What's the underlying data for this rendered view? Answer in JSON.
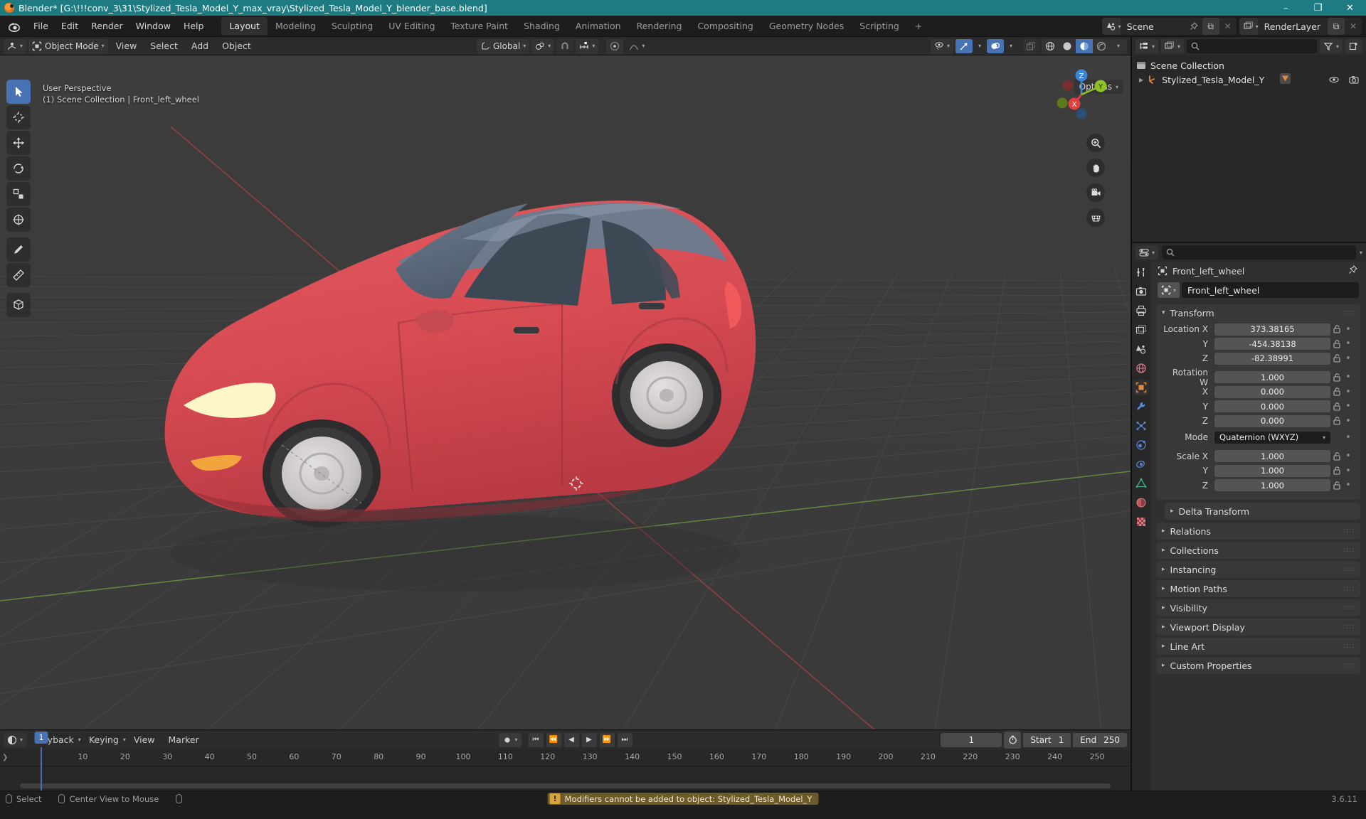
{
  "titlebar": {
    "title": "Blender* [G:\\!!!conv_3\\31\\Stylized_Tesla_Model_Y_max_vray\\Stylized_Tesla_Model_Y_blender_base.blend]",
    "icon": "blender-logo-icon",
    "minimize": "–",
    "maximize": "❐",
    "close": "✕"
  },
  "topbar": {
    "menus": [
      "File",
      "Edit",
      "Render",
      "Window",
      "Help"
    ],
    "workspaces": [
      {
        "label": "Layout",
        "active": true
      },
      {
        "label": "Modeling",
        "active": false
      },
      {
        "label": "Sculpting",
        "active": false
      },
      {
        "label": "UV Editing",
        "active": false
      },
      {
        "label": "Texture Paint",
        "active": false
      },
      {
        "label": "Shading",
        "active": false
      },
      {
        "label": "Animation",
        "active": false
      },
      {
        "label": "Rendering",
        "active": false
      },
      {
        "label": "Compositing",
        "active": false
      },
      {
        "label": "Geometry Nodes",
        "active": false
      },
      {
        "label": "Scripting",
        "active": false
      }
    ],
    "add_workspace": "+",
    "scene": {
      "label": "Scene",
      "icon": "scene-icon"
    },
    "view_layer": {
      "label": "RenderLayer",
      "icon": "view-layer-icon"
    },
    "new_btn": "⧉",
    "unlink_btn": "✕"
  },
  "viewport_header": {
    "editor_type": "editor-type-3dview-icon",
    "mode": "Object Mode",
    "menus": [
      "View",
      "Select",
      "Add",
      "Object"
    ],
    "transform_orientation": "Global",
    "snap_icon": "magnet-icon",
    "proportional_icon": "proportional-edit-icon",
    "options": "Options"
  },
  "viewport": {
    "perspective_line1": "User Perspective",
    "perspective_line2": "(1) Scene Collection | Front_left_wheel",
    "gizmo_axes": [
      {
        "label": "X",
        "color": "#e04040"
      },
      {
        "label": "Y",
        "color": "#8ec224"
      },
      {
        "label": "Z",
        "color": "#3a85d6"
      }
    ],
    "nav_buttons": [
      "zoom-icon",
      "hand-pan-icon",
      "camera-view-icon",
      "toggle-ortho-icon"
    ],
    "tools": [
      {
        "name": "tweak-select-tool",
        "active": true
      },
      {
        "name": "cursor-tool",
        "active": false
      },
      {
        "name": "move-tool",
        "active": false
      },
      {
        "name": "rotate-tool",
        "active": false
      },
      {
        "name": "scale-tool",
        "active": false
      },
      {
        "name": "transform-tool",
        "active": false
      },
      {
        "name": "annotate-tool",
        "active": false
      },
      {
        "name": "measure-tool",
        "active": false
      },
      {
        "name": "add-cube-tool",
        "active": false
      }
    ]
  },
  "outliner": {
    "display_mode_icon": "outliner-display-mode-icon",
    "filter_icon": "filter-icon",
    "new_collection_icon": "new-collection-icon",
    "search_placeholder": "",
    "rows": [
      {
        "label": "Scene Collection",
        "icon": "scene-collection-icon",
        "indent": false,
        "expand": ""
      },
      {
        "label": "Stylized_Tesla_Model_Y",
        "icon": "armature-object-icon",
        "indent": true,
        "expand": "▶",
        "badge": "modifier-icon"
      }
    ]
  },
  "properties": {
    "search_placeholder": "",
    "tabs": [
      {
        "name": "tool-tab",
        "active": false
      },
      {
        "name": "render-tab",
        "active": false
      },
      {
        "name": "output-tab",
        "active": false
      },
      {
        "name": "view-layer-tab",
        "active": false
      },
      {
        "name": "scene-tab",
        "active": false
      },
      {
        "name": "world-tab",
        "active": false
      },
      {
        "name": "object-tab",
        "active": true
      },
      {
        "name": "modifier-tab",
        "active": false
      },
      {
        "name": "particles-tab",
        "active": false
      },
      {
        "name": "physics-tab",
        "active": false
      },
      {
        "name": "constraint-tab",
        "active": false
      },
      {
        "name": "data-tab",
        "active": false
      },
      {
        "name": "material-tab",
        "active": false
      },
      {
        "name": "texture-tab",
        "active": false
      }
    ],
    "breadcrumb_object": "Front_left_wheel",
    "id_name": "Front_left_wheel",
    "transform": {
      "title": "Transform",
      "rows": [
        {
          "label": "Location X",
          "value": "373.38165"
        },
        {
          "label": "Y",
          "value": "-454.38138"
        },
        {
          "label": "Z",
          "value": "-82.38991"
        }
      ],
      "rotation": [
        {
          "label": "Rotation W",
          "value": "1.000"
        },
        {
          "label": "X",
          "value": "0.000"
        },
        {
          "label": "Y",
          "value": "0.000"
        },
        {
          "label": "Z",
          "value": "0.000"
        }
      ],
      "mode_label": "Mode",
      "mode_value": "Quaternion (WXYZ)",
      "scale": [
        {
          "label": "Scale X",
          "value": "1.000"
        },
        {
          "label": "Y",
          "value": "1.000"
        },
        {
          "label": "Z",
          "value": "1.000"
        }
      ],
      "delta_transform": "Delta Transform"
    },
    "panels": [
      "Relations",
      "Collections",
      "Instancing",
      "Motion Paths",
      "Visibility",
      "Viewport Display",
      "Line Art",
      "Custom Properties"
    ]
  },
  "timeline": {
    "editor_icon": "timeline-editor-icon",
    "menus": [
      "Playback",
      "Keying",
      "View",
      "Marker"
    ],
    "transport": [
      "⏮",
      "⏪",
      "◀",
      "▶",
      "⏩",
      "⏭"
    ],
    "current_frame": "1",
    "start_label": "Start",
    "start_value": "1",
    "end_label": "End",
    "end_value": "250",
    "ticks": [
      "1",
      "10",
      "20",
      "30",
      "40",
      "50",
      "60",
      "70",
      "80",
      "90",
      "100",
      "110",
      "120",
      "130",
      "140",
      "150",
      "160",
      "170",
      "180",
      "190",
      "200",
      "210",
      "220",
      "230",
      "240",
      "250"
    ],
    "playhead": "1"
  },
  "statusbar": {
    "items": [
      {
        "icon": "mouse-left-icon",
        "label": "Select"
      },
      {
        "icon": "mouse-middle-icon",
        "label": "Center View to Mouse"
      },
      {
        "icon": "mouse-right-icon",
        "label": ""
      }
    ],
    "report": "Modifiers cannot be added to object: Stylized_Tesla_Model_Y",
    "report_icon": "warning-icon",
    "version": "3.6.11"
  },
  "colors": {
    "accent": "#4772b3",
    "title_bar": "#1f7b82",
    "car_body": "#d94f57",
    "glass": "#5f6e80",
    "wheel": "#c9c6c6",
    "headlight": "#fdf6c8",
    "warning": "#6b5a2a"
  }
}
